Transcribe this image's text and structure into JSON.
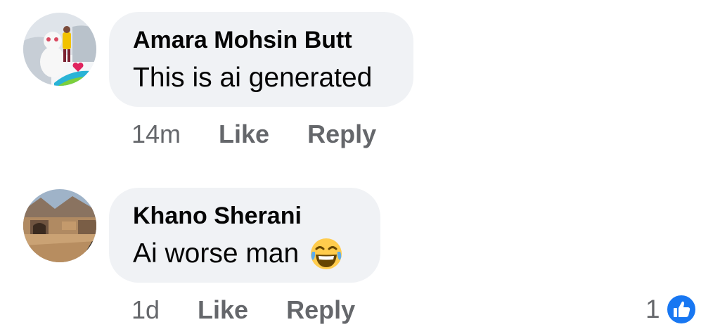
{
  "comments": [
    {
      "author": "Amara Mohsin Butt",
      "text": "This is ai generated",
      "time": "14m",
      "like_label": "Like",
      "reply_label": "Reply",
      "avatar_icon": "avatar-photo-snowman"
    },
    {
      "author": "Khano Sherani",
      "text": "Ai worse man",
      "emoji": "face-with-tears-of-joy-icon",
      "time": "1d",
      "like_label": "Like",
      "reply_label": "Reply",
      "reaction_count": "1",
      "reaction_icon": "like-thumbs-up-icon",
      "avatar_icon": "avatar-photo-game-scene"
    }
  ],
  "colors": {
    "bubble": "#f0f2f5",
    "text": "#050505",
    "meta": "#65676b",
    "like_blue": "#1877f2",
    "emoji_yellow": "#ffcc4d"
  }
}
